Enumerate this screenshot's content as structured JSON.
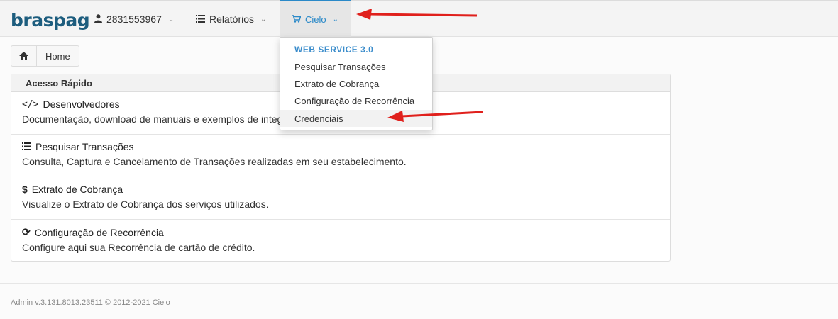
{
  "navbar": {
    "logo": "braspag",
    "user_label": "2831553967",
    "reports_label": "Relatórios",
    "cielo_label": "Cielo"
  },
  "breadcrumb": {
    "home_label": "Home"
  },
  "panel": {
    "title": "Acesso Rápido",
    "rows": [
      {
        "icon": "code-icon",
        "title": "Desenvolvedores",
        "desc": "Documentação, download de manuais e exemplos de integ"
      },
      {
        "icon": "list-icon",
        "title": "Pesquisar Transações",
        "desc": "Consulta, Captura e Cancelamento de Transações realizadas em seu estabelecimento."
      },
      {
        "icon": "dollar-icon",
        "title": "Extrato de Cobrança",
        "desc": "Visualize o Extrato de Cobrança dos serviços utilizados."
      },
      {
        "icon": "refresh-icon",
        "title": "Configuração de Recorrência",
        "desc": "Configure aqui sua Recorrência de cartão de crédito."
      }
    ]
  },
  "dropdown": {
    "header": "WEB SERVICE 3.0",
    "items": [
      "Pesquisar Transações",
      "Extrato de Cobrança",
      "Configuração de Recorrência",
      "Credenciais"
    ]
  },
  "footer": {
    "text": "Admin v.3.131.8013.23511 © 2012-2021 Cielo"
  },
  "colors": {
    "brand": "#1d5d7e",
    "accent": "#2a89c8",
    "arrow": "#e0201c"
  }
}
